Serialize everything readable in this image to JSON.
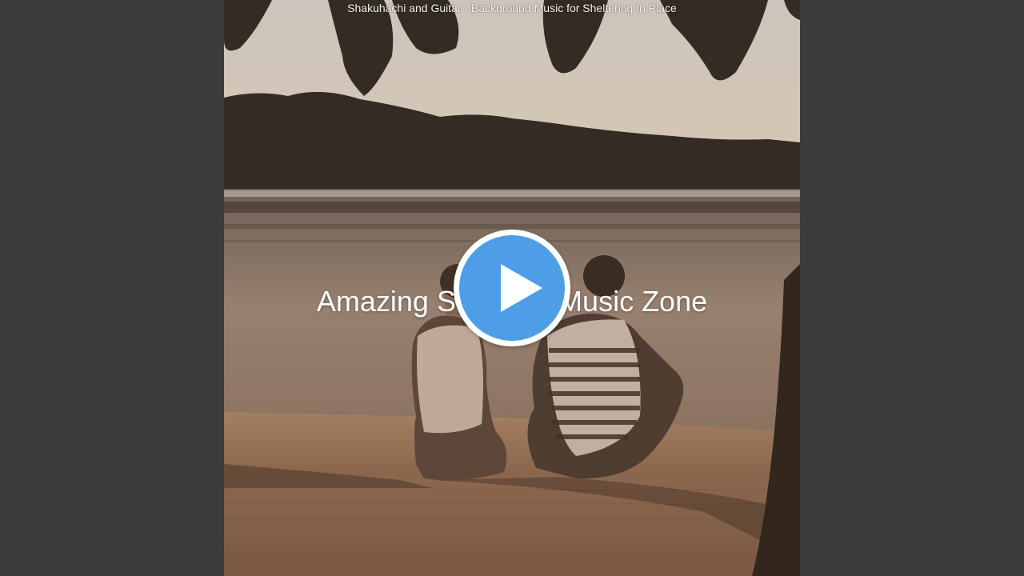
{
  "video": {
    "title": "Shakuhachi and Guitar - Background Music for Sheltering In Place",
    "channel_overlay": "Amazing Soothing Music Zone"
  },
  "player": {
    "play_icon": "play-icon",
    "accent_color": "#4d9ee6",
    "background_color": "#3b3b3b"
  }
}
